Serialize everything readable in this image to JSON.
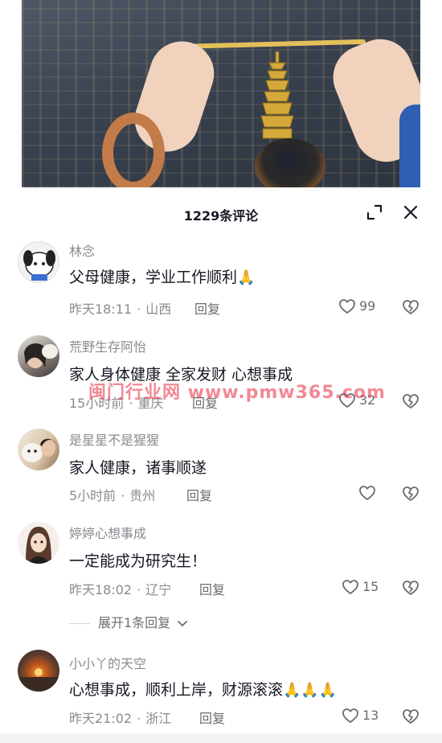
{
  "sheet": {
    "comment_count": "1229条评论",
    "icons": {
      "expand": "expand-icon",
      "close": "close-icon"
    }
  },
  "comments": [
    {
      "username": "林念",
      "text": "父母健康，学业工作顺利",
      "emoji": "🙏",
      "time": "昨天18:11",
      "location": "山西",
      "reply_label": "回复",
      "likes": "99",
      "avatar_color": "#f4f4f4"
    },
    {
      "username": "荒野生存阿怡",
      "text": "家人身体健康 全家发财 心想事成",
      "time": "15小时前",
      "location": "重庆",
      "reply_label": "回复",
      "likes": "32",
      "avatar_color": "#6e6a66"
    },
    {
      "username": "是星星不是猩猩",
      "text": "家人健康，诸事顺遂",
      "time": "5小时前",
      "location": "贵州",
      "reply_label": "回复",
      "likes": "",
      "avatar_color": "#cdb89b"
    },
    {
      "username": "婷婷心想事成",
      "text": "一定能成为研究生！",
      "time": "昨天18:02",
      "location": "辽宁",
      "reply_label": "回复",
      "likes": "15",
      "avatar_color": "#e8d9cf",
      "expand_replies": "展开1条回复"
    },
    {
      "username": "小小丫的天空",
      "text": "心想事成，顺利上岸，财源滚滚",
      "emoji": "🙏🙏🙏",
      "time": "昨天21:02",
      "location": "浙江",
      "reply_label": "回复",
      "likes": "13",
      "avatar_color": "#3b2c22"
    }
  ],
  "watermark": "闽门行业网  www.pmw365.com",
  "colors": {
    "text": "#161823",
    "meta": "#8a8b91",
    "background": "#ffffff"
  }
}
